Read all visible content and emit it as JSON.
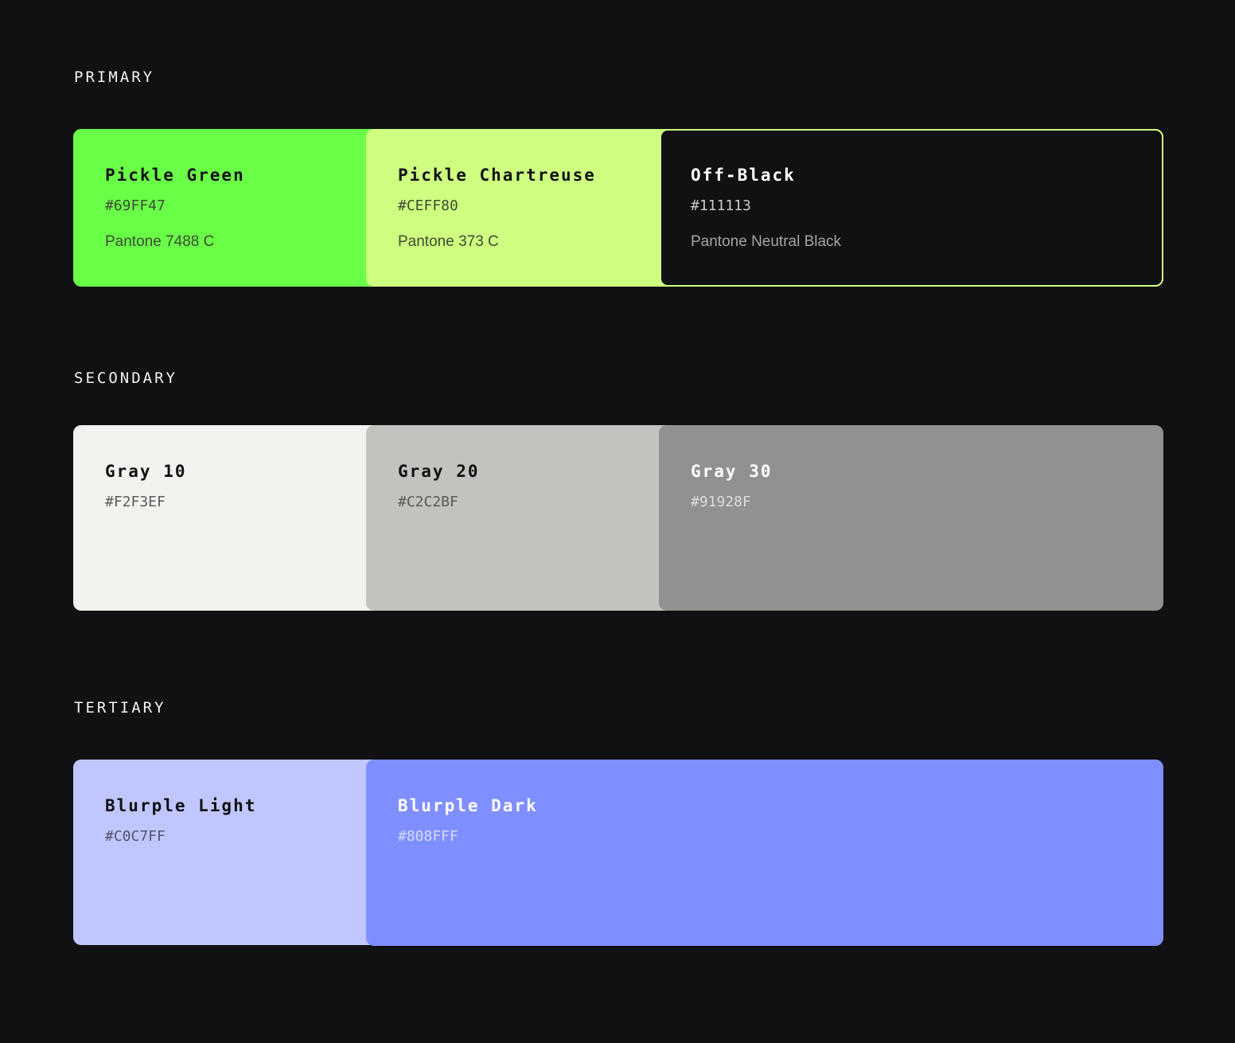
{
  "sections": {
    "primary": {
      "title": "PRIMARY",
      "swatches": [
        {
          "name": "Pickle Green",
          "hex": "#69FF47",
          "pantone": "Pantone 7488 C",
          "color": "#69FF47"
        },
        {
          "name": "Pickle Chartreuse",
          "hex": "#CEFF80",
          "pantone": "Pantone 373 C",
          "color": "#CEFF80"
        },
        {
          "name": "Off-Black",
          "hex": "#111113",
          "pantone": "Pantone Neutral Black",
          "color": "#111113"
        }
      ]
    },
    "secondary": {
      "title": "SECONDARY",
      "swatches": [
        {
          "name": "Gray 10",
          "hex": "#F2F3EF",
          "color": "#F2F3EF"
        },
        {
          "name": "Gray 20",
          "hex": "#C2C2BF",
          "color": "#C2C2BF"
        },
        {
          "name": "Gray 30",
          "hex": "#91928F",
          "color": "#91928F"
        }
      ]
    },
    "tertiary": {
      "title": "TERTIARY",
      "swatches": [
        {
          "name": "Blurple Light",
          "hex": "#C0C7FF",
          "color": "#C0C7FF"
        },
        {
          "name": "Blurple Dark",
          "hex": "#808FFF",
          "color": "#808FFF"
        }
      ]
    }
  }
}
